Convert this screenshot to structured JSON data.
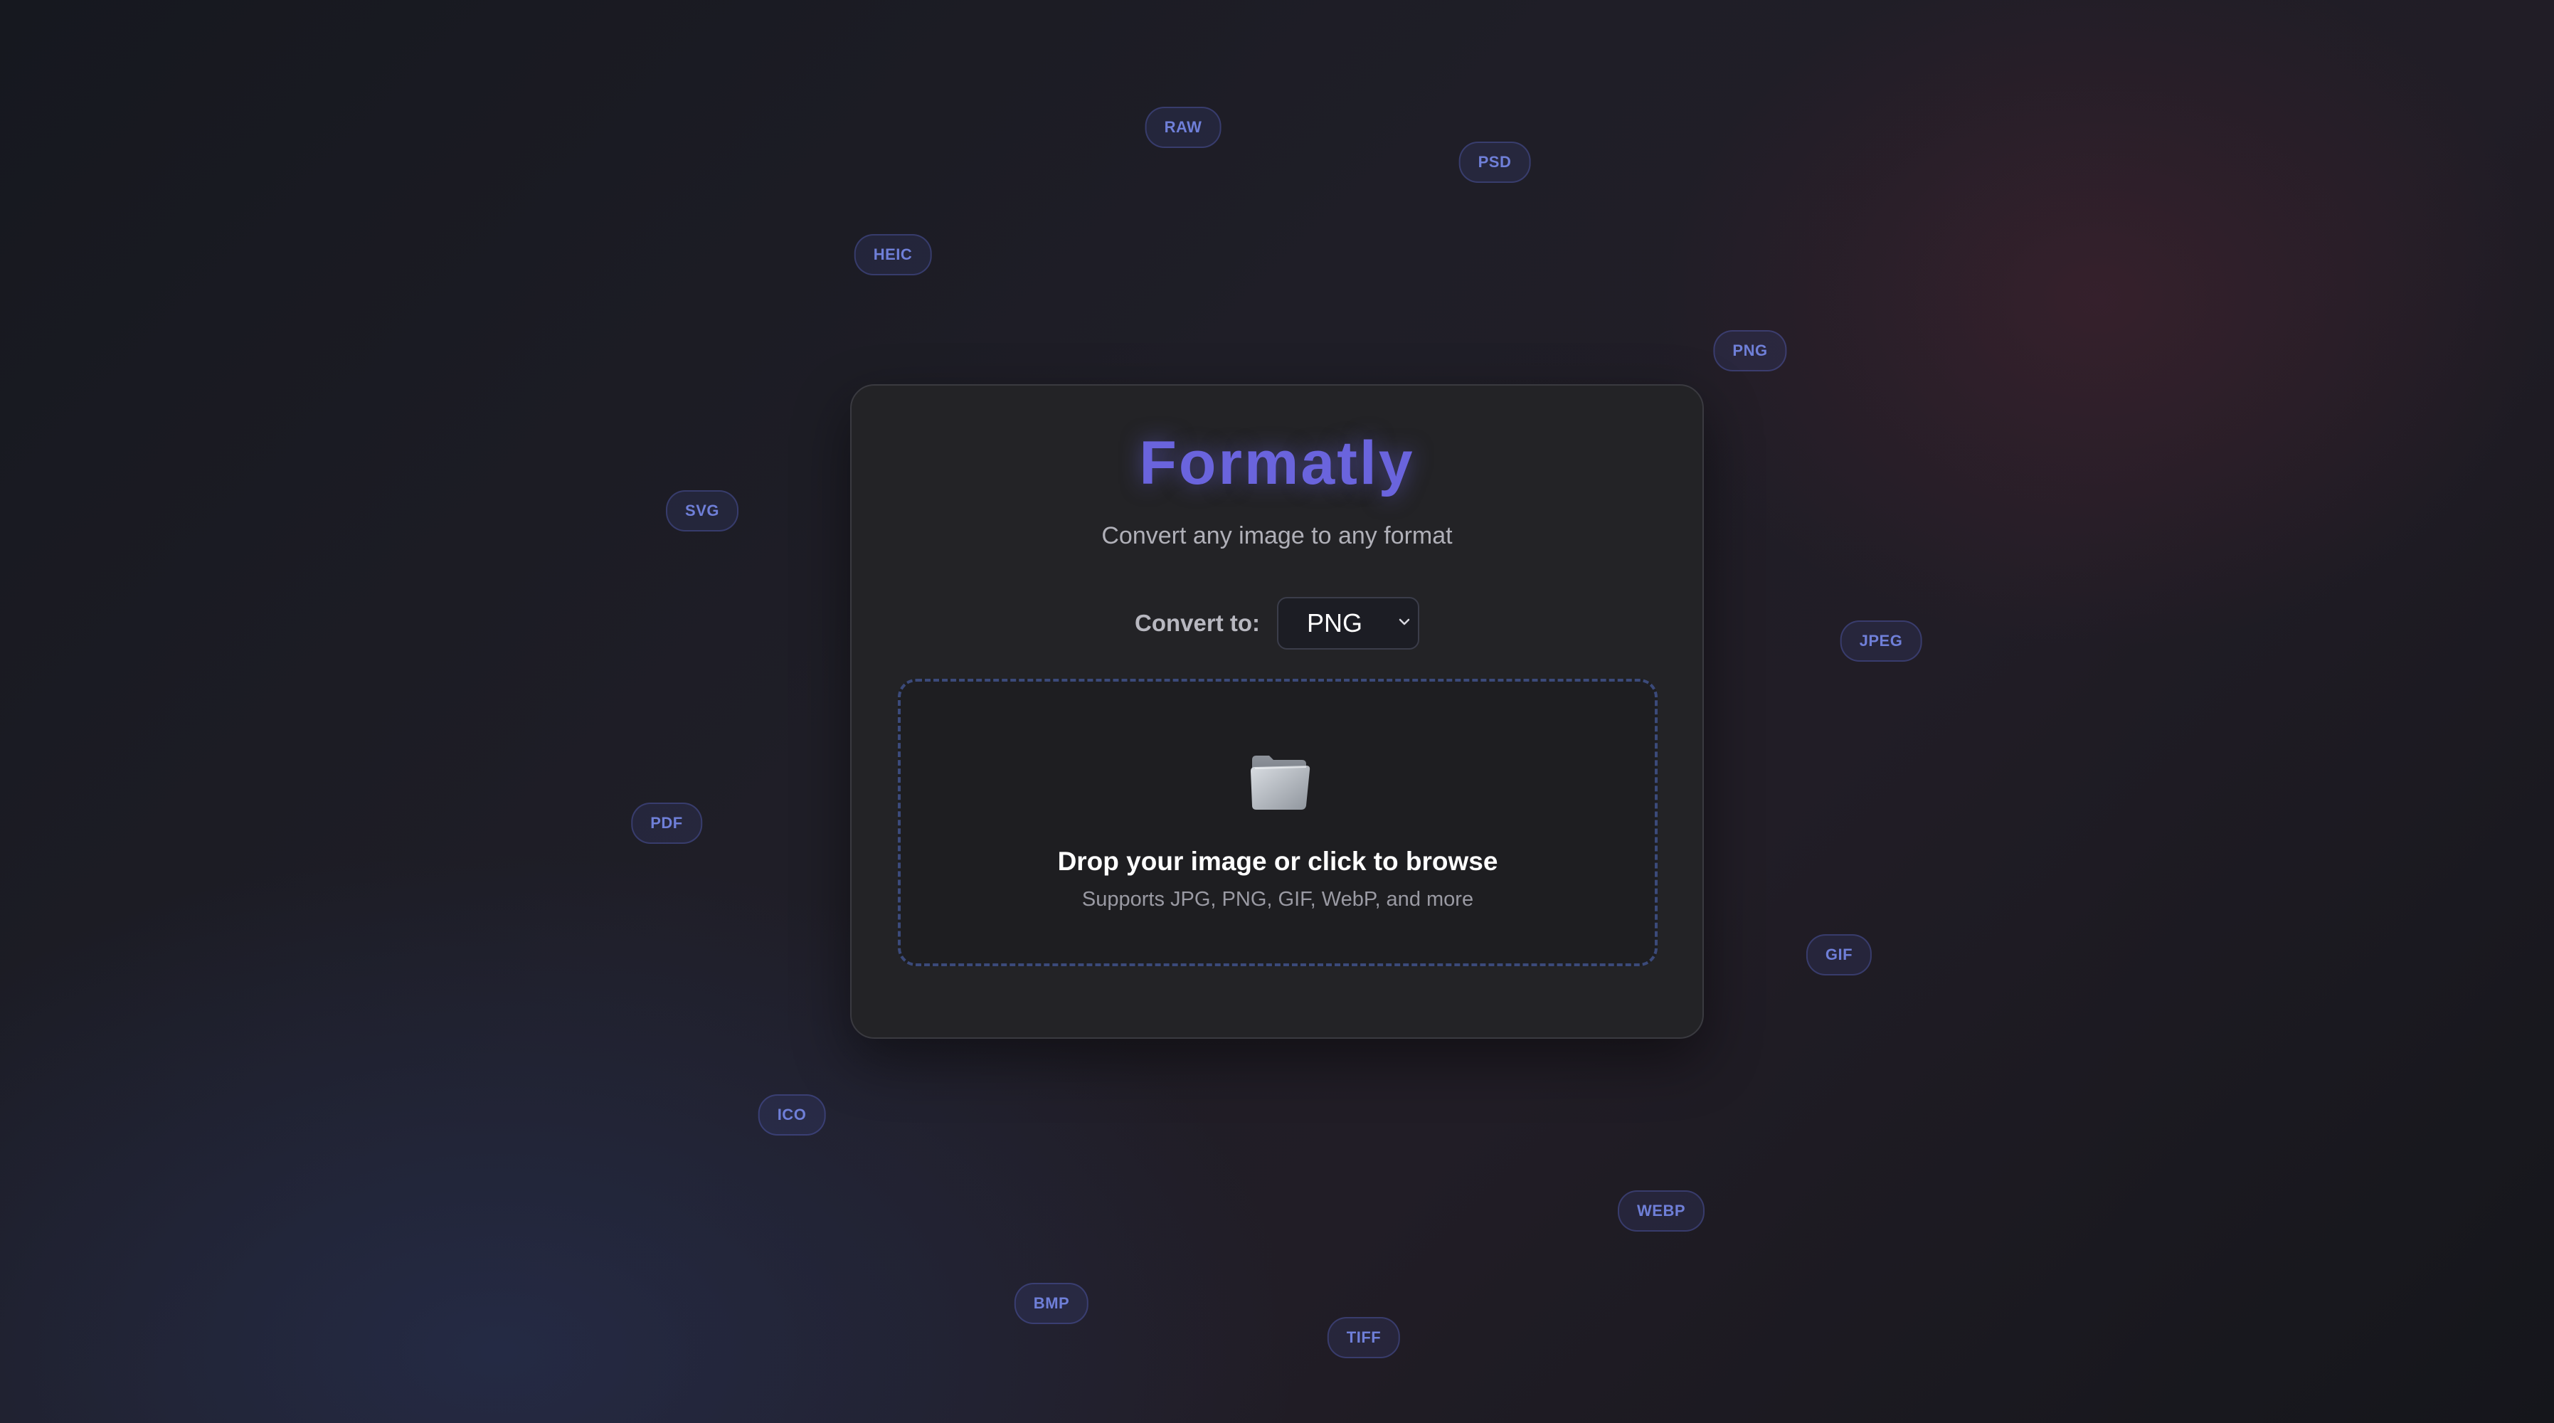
{
  "app": {
    "title": "Formatly",
    "subtitle": "Convert any image to any format"
  },
  "converter": {
    "label": "Convert to:",
    "selected_format": "PNG"
  },
  "dropzone": {
    "icon": "folder-icon",
    "title": "Drop your image or click to browse",
    "subtitle": "Supports JPG, PNG, GIF, WebP, and more"
  },
  "format_badges": [
    "RAW",
    "PSD",
    "HEIC",
    "PNG",
    "SVG",
    "JPEG",
    "PDF",
    "GIF",
    "ICO",
    "WEBP",
    "BMP",
    "TIFF"
  ],
  "colors": {
    "accent": "#6a64dd",
    "badge_text": "#6f7fd8",
    "card_bg": "#232326"
  }
}
